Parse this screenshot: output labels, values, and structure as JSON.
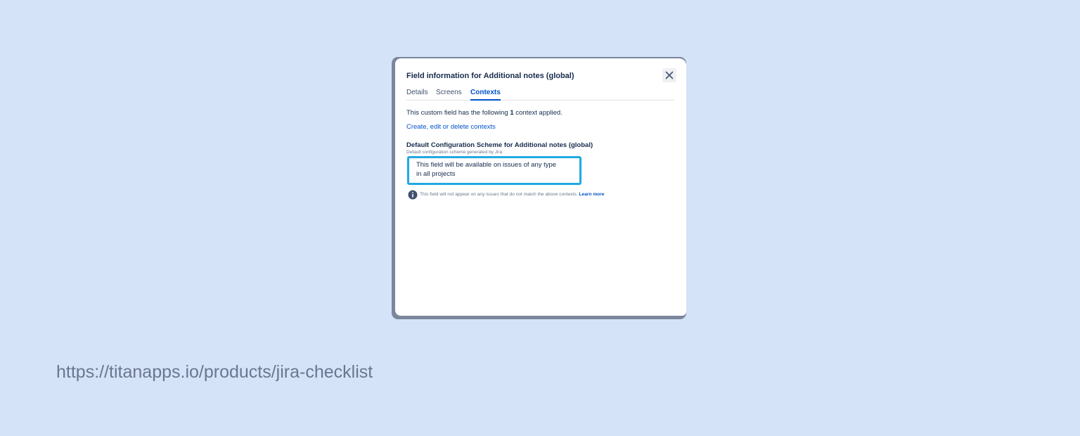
{
  "dialog": {
    "title": "Field information for Additional notes (global)",
    "tabs": [
      {
        "label": "Details",
        "active": false
      },
      {
        "label": "Screens",
        "active": false
      },
      {
        "label": "Contexts",
        "active": true
      }
    ],
    "summary": {
      "before": "This custom field has the following ",
      "count": "1",
      "after": " context applied."
    },
    "contexts_link": "Create, edit or delete contexts",
    "scheme": {
      "name": "Default Configuration Scheme for Additional notes (global)",
      "description": "Default configuration scheme generated by Jira",
      "availability_line_1": "This field will be available on issues of any type",
      "availability_line_2": "in all projects"
    },
    "info": {
      "icon": "info-icon",
      "text": "This field will not appear on any issues that do not match the above contexts.",
      "link": "Learn more"
    },
    "close_icon": "close-icon"
  },
  "footer": {
    "url": "https://titanapps.io/products/jira-checklist"
  },
  "colors": {
    "background": "#d4e3f7",
    "accent": "#0052cc",
    "highlight": "#1fa9e3",
    "text": "#172b4d"
  }
}
